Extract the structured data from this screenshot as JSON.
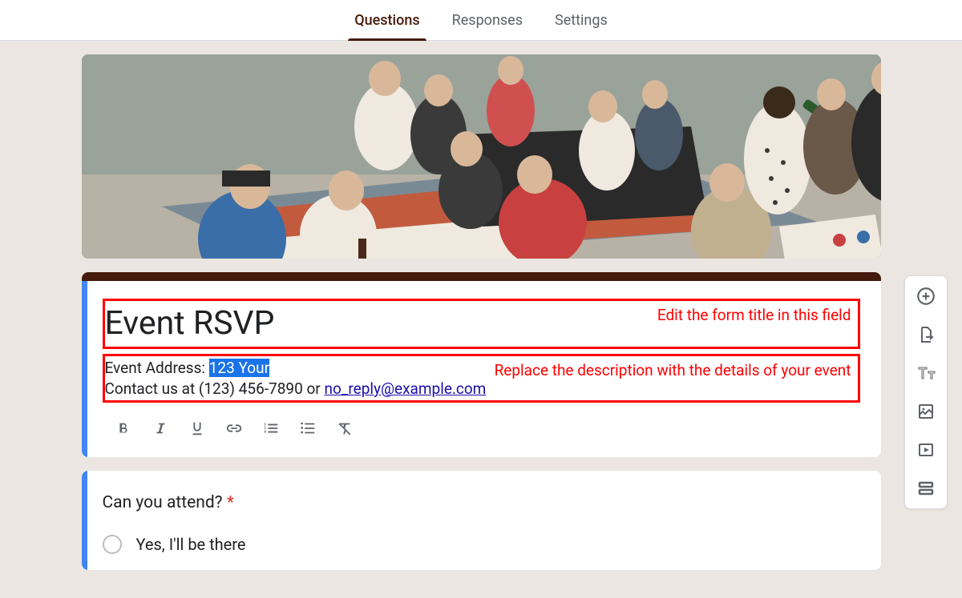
{
  "tabs": {
    "questions": "Questions",
    "responses": "Responses",
    "settings": "Settings"
  },
  "annotations": {
    "title": "Edit the form title in this field",
    "description": "Replace the description with the details of your event"
  },
  "form": {
    "title": "Event RSVP",
    "desc_prefix": "Event Address: ",
    "desc_highlight": "123 Your",
    "desc_line2_pre": "Contact us at (123) 456-7890 or ",
    "desc_link": "no_reply@example.com"
  },
  "question": {
    "title": "Can you attend? ",
    "required_mark": "*",
    "option1": "Yes,  I'll be there"
  },
  "side_icons": {
    "add": "add-circle-icon",
    "import": "import-icon",
    "text": "title-text-icon",
    "image": "image-icon",
    "video": "video-icon",
    "section": "section-icon"
  }
}
